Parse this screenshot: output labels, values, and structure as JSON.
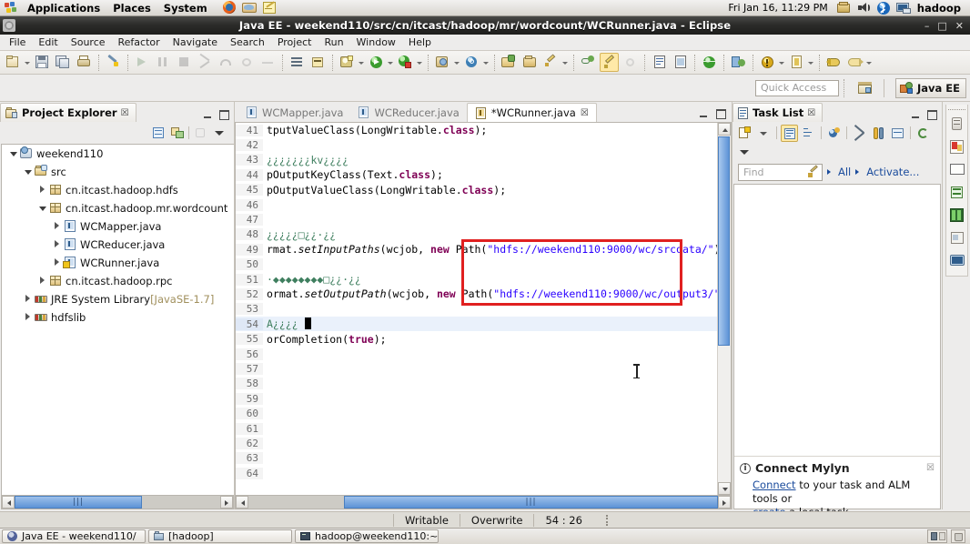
{
  "desktop": {
    "panel": {
      "menus": [
        "Applications",
        "Places",
        "System"
      ],
      "launchers": [
        "firefox-icon",
        "email-icon",
        "notes-icon"
      ],
      "clock": "Fri Jan 16, 11:29 PM",
      "tray": [
        "archive-icon",
        "volume-icon",
        "bluetooth-icon",
        "network-icon"
      ],
      "user": "hadoop"
    },
    "taskbar": {
      "items": [
        {
          "icon": "eclipse-icon",
          "label": "Java EE - weekend110/"
        },
        {
          "icon": "folder-icon",
          "label": "[hadoop]"
        },
        {
          "icon": "terminal-icon",
          "label": "hadoop@weekend110:~"
        }
      ],
      "tray": [
        "workspace-icon",
        "trash-icon"
      ]
    }
  },
  "window": {
    "title": "Java EE - weekend110/src/cn/itcast/hadoop/mr/wordcount/WCRunner.java - Eclipse",
    "icon": "eclipse-icon",
    "buttons": {
      "minimize": "–",
      "maximize": "□",
      "close": "✕"
    }
  },
  "menubar": {
    "items": [
      "File",
      "Edit",
      "Source",
      "Refactor",
      "Navigate",
      "Search",
      "Project",
      "Run",
      "Window",
      "Help"
    ]
  },
  "toolbar": {
    "groups": [
      [
        "new-wizard-icon",
        "dropdown-arrow",
        "save-icon",
        "save-all-icon",
        "print-icon"
      ],
      [
        "toggle-markoccurrences-icon"
      ],
      [
        "run-last-tool-icon",
        "pause-icon",
        "stop-icon",
        "step-into-icon",
        "step-over-icon",
        "step-return-icon",
        "more-debug-icon"
      ],
      [
        "open-type-icon",
        "open-task-icon"
      ],
      [
        "new-java-package-icon",
        "dropdown-arrow",
        "debug-run-icon",
        "dropdown-arrow",
        "run-as-icon",
        "dropdown-arrow"
      ],
      [
        "external-tools-icon",
        "dropdown-arrow",
        "search-icon",
        "dropdown-arrow"
      ],
      [
        "open-resource-icon",
        "open-folder-icon",
        "edit-icon",
        "dropdown-arrow"
      ],
      [
        "link-icon",
        "pencil-highlight-icon",
        "disabled-icon"
      ],
      [
        "outline-toggle-icon",
        "properties-icon"
      ],
      [
        "web-browser-icon"
      ],
      [
        "java-perspective-icon"
      ],
      [
        "warning-icon",
        "dropdown-arrow",
        "annotation-icon",
        "dropdown-arrow"
      ],
      [
        "back-icon",
        "forward-icon",
        "dropdown-arrow"
      ]
    ]
  },
  "quick_access": {
    "placeholder": "Quick Access",
    "perspective_open_icon": "open-perspective-icon",
    "current_perspective": "Java EE",
    "current_perspective_icon": "java-ee-icon"
  },
  "project_explorer": {
    "title": "Project Explorer",
    "close_glyph": "☒",
    "toolbar": [
      "collapse-all-icon",
      "link-with-editor-icon",
      "focus-icon",
      "view-menu-icon"
    ],
    "tree": [
      {
        "indent": 0,
        "twist": "open",
        "icon": "java-project-icon",
        "label": "weekend110",
        "dim": ""
      },
      {
        "indent": 1,
        "twist": "open",
        "icon": "source-folder-icon",
        "label": "src",
        "dim": ""
      },
      {
        "indent": 2,
        "twist": "closed",
        "icon": "package-icon",
        "label": "cn.itcast.hadoop.hdfs",
        "dim": ""
      },
      {
        "indent": 2,
        "twist": "open",
        "icon": "package-icon",
        "label": "cn.itcast.hadoop.mr.wordcount",
        "dim": ""
      },
      {
        "indent": 3,
        "twist": "closed",
        "icon": "java-file-icon",
        "label": "WCMapper.java",
        "dim": ""
      },
      {
        "indent": 3,
        "twist": "closed",
        "icon": "java-file-icon",
        "label": "WCReducer.java",
        "dim": ""
      },
      {
        "indent": 3,
        "twist": "closed",
        "icon": "java-file-dirty-icon",
        "label": "WCRunner.java",
        "dim": ""
      },
      {
        "indent": 2,
        "twist": "closed",
        "icon": "package-icon",
        "label": "cn.itcast.hadoop.rpc",
        "dim": ""
      },
      {
        "indent": 1,
        "twist": "closed",
        "icon": "library-icon",
        "label": "JRE System Library",
        "dim": "[JavaSE-1.7]"
      },
      {
        "indent": 1,
        "twist": "closed",
        "icon": "library-icon",
        "label": "hdfslib",
        "dim": ""
      }
    ]
  },
  "editor": {
    "tabs": [
      {
        "label": "WCMapper.java",
        "icon": "java-file-icon",
        "active": false,
        "dirty": false
      },
      {
        "label": "WCReducer.java",
        "icon": "java-file-icon",
        "active": false,
        "dirty": false
      },
      {
        "label": "*WCRunner.java",
        "icon": "java-file-dirty-icon",
        "active": true,
        "dirty": true,
        "close_glyph": "☒"
      }
    ],
    "first_line": 41,
    "current_line": 54,
    "lines": [
      {
        "n": 41,
        "tokens": [
          {
            "t": "tputValueClass(LongWritable.",
            "c": "plain"
          },
          {
            "t": "class",
            "c": "kw"
          },
          {
            "t": ");",
            "c": "plain"
          }
        ]
      },
      {
        "n": 42,
        "tokens": []
      },
      {
        "n": 43,
        "tokens": [
          {
            "t": "¿¿¿¿¿¿¿kv¿¿¿¿",
            "c": "cmt"
          }
        ]
      },
      {
        "n": 44,
        "tokens": [
          {
            "t": "pOutputKeyClass(Text.",
            "c": "plain"
          },
          {
            "t": "class",
            "c": "kw"
          },
          {
            "t": ");",
            "c": "plain"
          }
        ]
      },
      {
        "n": 45,
        "tokens": [
          {
            "t": "pOutputValueClass(LongWritable.",
            "c": "plain"
          },
          {
            "t": "class",
            "c": "kw"
          },
          {
            "t": ");",
            "c": "plain"
          }
        ]
      },
      {
        "n": 46,
        "tokens": []
      },
      {
        "n": 47,
        "tokens": []
      },
      {
        "n": 48,
        "tokens": [
          {
            "t": "¿¿¿¿¿□¿¿·¿¿",
            "c": "cmt"
          }
        ]
      },
      {
        "n": 49,
        "tokens": [
          {
            "t": "rmat.",
            "c": "plain"
          },
          {
            "t": "setInputPaths",
            "c": "mth"
          },
          {
            "t": "(wcjob, ",
            "c": "plain"
          },
          {
            "t": "new",
            "c": "kw"
          },
          {
            "t": " Path(",
            "c": "plain"
          },
          {
            "t": "\"hdfs://weekend110:9000/wc/srcdata/\"",
            "c": "str"
          },
          {
            "t": ");",
            "c": "plain"
          }
        ]
      },
      {
        "n": 50,
        "tokens": []
      },
      {
        "n": 51,
        "tokens": [
          {
            "t": "·◆◆◆◆◆◆◆◆□¿¿·¿¿",
            "c": "cmt"
          }
        ]
      },
      {
        "n": 52,
        "tokens": [
          {
            "t": "ormat.",
            "c": "plain"
          },
          {
            "t": "setOutputPath",
            "c": "mth"
          },
          {
            "t": "(wcjob, ",
            "c": "plain"
          },
          {
            "t": "new",
            "c": "kw"
          },
          {
            "t": " Path(",
            "c": "plain"
          },
          {
            "t": "\"hdfs://weekend110:9000/wc/output3/\"",
            "c": "str"
          },
          {
            "t": ");",
            "c": "plain"
          }
        ]
      },
      {
        "n": 53,
        "tokens": []
      },
      {
        "n": 54,
        "tokens": [
          {
            "t": "A¿¿¿¿",
            "c": "cmt"
          }
        ],
        "caret": true
      },
      {
        "n": 55,
        "tokens": [
          {
            "t": "orCompletion(",
            "c": "plain"
          },
          {
            "t": "true",
            "c": "kw"
          },
          {
            "t": ");",
            "c": "plain"
          }
        ]
      },
      {
        "n": 56,
        "tokens": []
      },
      {
        "n": 57,
        "tokens": []
      },
      {
        "n": 58,
        "tokens": []
      },
      {
        "n": 59,
        "tokens": []
      },
      {
        "n": 60,
        "tokens": []
      },
      {
        "n": 61,
        "tokens": []
      },
      {
        "n": 62,
        "tokens": []
      },
      {
        "n": 63,
        "tokens": []
      },
      {
        "n": 64,
        "tokens": []
      }
    ],
    "annotation": {
      "name": "red-highlight-box",
      "color": "#e02020"
    }
  },
  "task_list": {
    "title": "Task List",
    "close_glyph": "☒",
    "toolbar": [
      "new-task-icon",
      "dropdown-arrow",
      "categorized-icon",
      "scheduled-icon",
      "focus-icon",
      "clear-icon",
      "synchronize-icon",
      "collapse-icon",
      "refresh-icon"
    ],
    "menu_icon": "view-menu-icon",
    "find_placeholder": "Find",
    "find_clear_icon": "clear-brush-icon",
    "filters": [
      "All",
      "Activate..."
    ],
    "mylyn": {
      "icon": "info-icon",
      "title": "Connect Mylyn",
      "close_glyph": "☒",
      "link1": "Connect",
      "text1": " to your task and ALM tools or",
      "link2": "create",
      "text2": " a local task."
    }
  },
  "fastview": {
    "buttons": [
      "servers-icon",
      "problems-icon",
      "console-icon",
      "snippets-icon",
      "data-source-icon",
      "properties-view-icon",
      "terminal-view-icon"
    ]
  },
  "status_bar": {
    "writable": "Writable",
    "insert_mode": "Overwrite",
    "position": "54 : 26"
  }
}
